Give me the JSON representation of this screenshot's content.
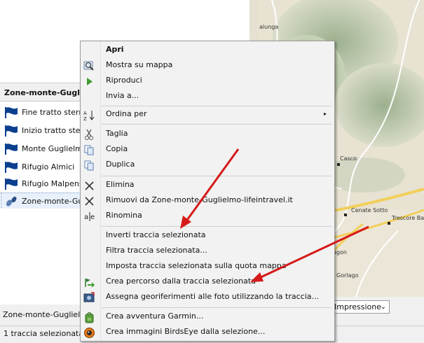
{
  "tree": {
    "header": "Zone-monte-Guglielmo",
    "items": [
      {
        "label": "Fine tratto sterrato",
        "icon": "waypoint-flag-icon"
      },
      {
        "label": "Inizio tratto sterrato",
        "icon": "waypoint-flag-icon"
      },
      {
        "label": "Monte Guglielmo",
        "icon": "waypoint-flag-icon"
      },
      {
        "label": "Rifugio Almici",
        "icon": "waypoint-flag-icon"
      },
      {
        "label": "Rifugio Malpensata",
        "icon": "waypoint-flag-icon"
      },
      {
        "label": "Zone-monte-Guglielmo-lifeintravel.it",
        "icon": "track-footprints-icon",
        "selected": true
      }
    ]
  },
  "bottom_title": "Zone-monte-Guglielmo",
  "status": "1 traccia selezionata",
  "map": {
    "labels": [
      "alunga",
      "Casco",
      "Cenate Sotto",
      "Trescore Balneario",
      "agon",
      "Gorlago"
    ],
    "profile_select": {
      "value": "Impressione",
      "options": [
        "Impressione"
      ]
    }
  },
  "context_menu": {
    "items": [
      {
        "label": "Apri",
        "bold": true,
        "icon": ""
      },
      {
        "label": "Mostra su mappa",
        "icon": "magnifier-map-icon"
      },
      {
        "label": "Riproduci",
        "icon": "play-icon"
      },
      {
        "label": "Invia a...",
        "icon": ""
      },
      {
        "label": "Ordina per",
        "icon": "sort-az-icon",
        "submenu": true
      },
      {
        "label": "Taglia",
        "icon": "scissors-icon"
      },
      {
        "label": "Copia",
        "icon": "copy-icon"
      },
      {
        "label": "Duplica",
        "icon": "duplicate-icon"
      },
      {
        "label": "Elimina",
        "icon": "delete-x-icon"
      },
      {
        "label": "Rimuovi da Zone-monte-Guglielmo-lifeintravel.it",
        "icon": "remove-x-icon"
      },
      {
        "label": "Rinomina",
        "icon": "rename-icon"
      },
      {
        "label": "Inverti traccia selezionata",
        "icon": ""
      },
      {
        "label": "Filtra traccia selezionata...",
        "icon": ""
      },
      {
        "label": "Imposta traccia selezionata sulla quota mappa",
        "icon": ""
      },
      {
        "label": "Crea percorso dalla traccia selezionata",
        "icon": "route-flags-icon"
      },
      {
        "label": "Assegna georiferimenti alle foto utilizzando la traccia...",
        "icon": "photo-geotag-icon"
      },
      {
        "label": "Crea avventura Garmin...",
        "icon": "backpack-icon"
      },
      {
        "label": "Crea immagini BirdsEye dalla selezione...",
        "icon": "birdseye-icon"
      }
    ],
    "submenu_arrow": "▸"
  },
  "colors": {
    "menu_bg": "#f2f2f2",
    "flag_blue": "#0b3f8f",
    "arrow_red": "#d51a1a",
    "road_yellow": "#f2cf5a"
  }
}
